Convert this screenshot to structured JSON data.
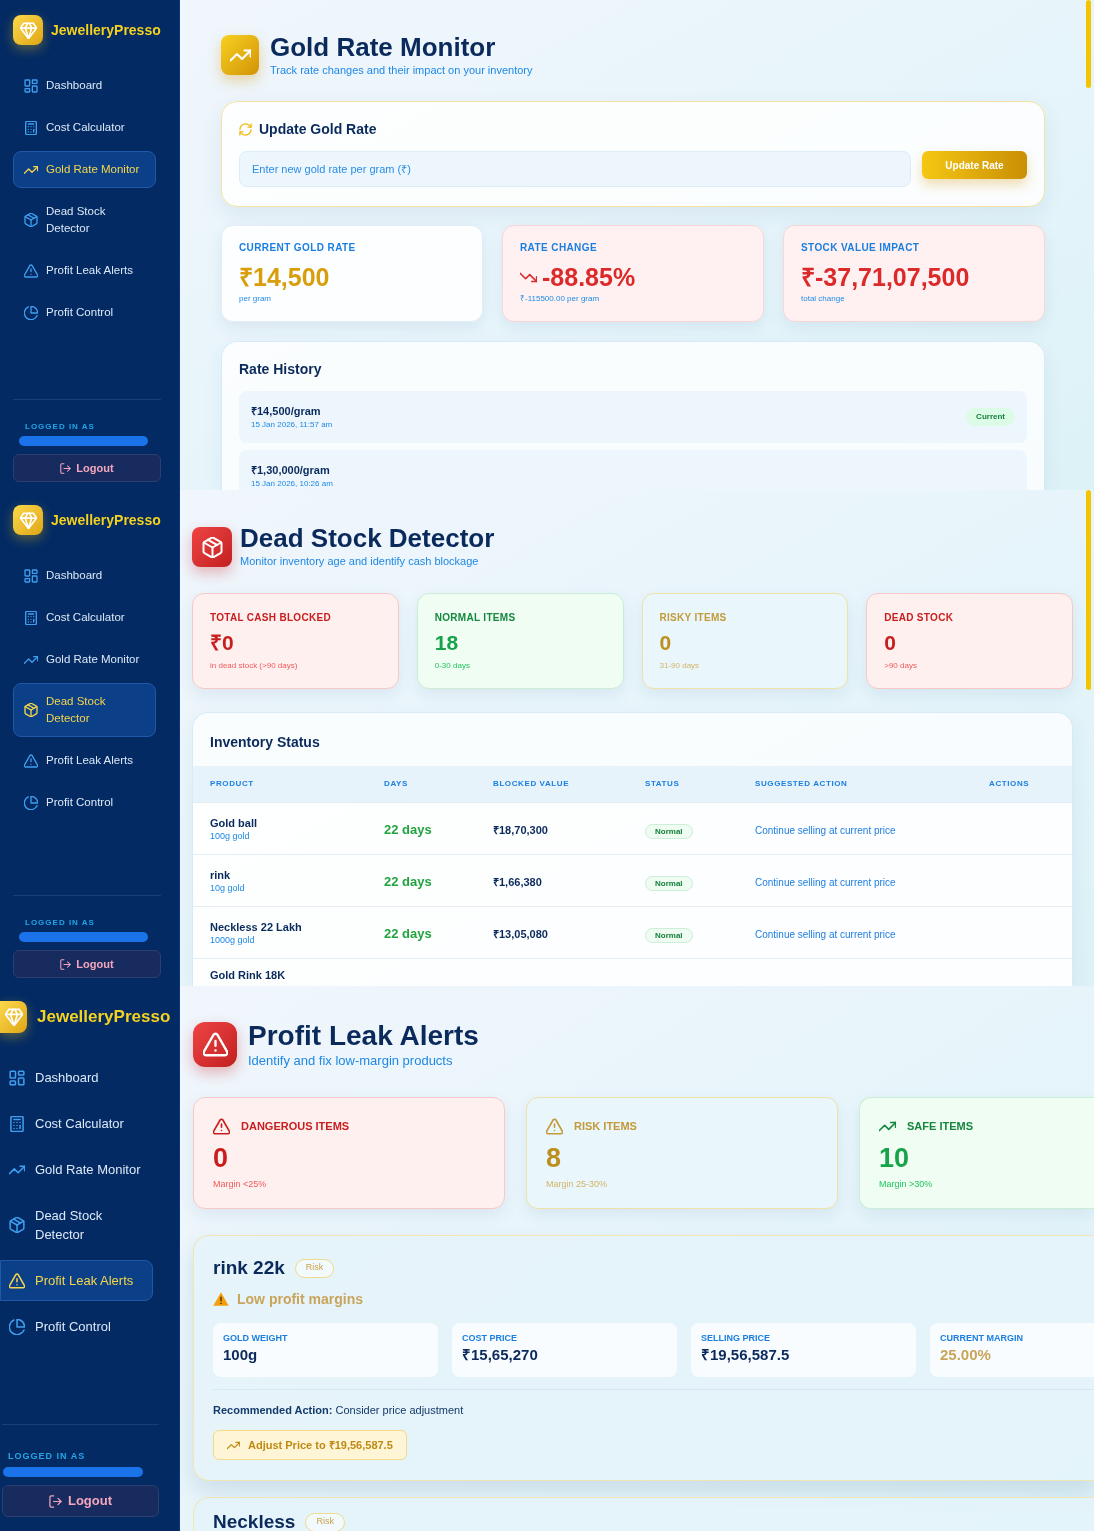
{
  "screens": [
    {
      "sidebar": {
        "brand": "JewelleryPresso",
        "nav": [
          {
            "label": "Dashboard",
            "selected": false
          },
          {
            "label": "Cost Calculator",
            "selected": false
          },
          {
            "label": "Gold Rate Monitor",
            "selected": true
          },
          {
            "label": "Dead Stock Detector",
            "selected": false
          },
          {
            "label": "Profit Leak Alerts",
            "selected": false
          },
          {
            "label": "Profit Control",
            "selected": false
          }
        ],
        "account_label": "LOGGED IN AS",
        "logout": "Logout"
      },
      "scrollbar": true,
      "page": {
        "kind": "rates",
        "title": "Gold Rate Monitor",
        "subtitle": "Track rate changes and their impact on your inventory",
        "update": {
          "heading": "Update Gold Rate",
          "placeholder": "Enter new gold rate per gram (₹)",
          "button": "Update Rate"
        },
        "stats": [
          {
            "kind": "plain",
            "label": "CURRENT GOLD RATE",
            "value": "₹14,500",
            "note": "per gram"
          },
          {
            "kind": "loss",
            "label": "RATE CHANGE",
            "value": "-88.85%",
            "note": "₹-115500.00 per gram",
            "falling": true
          },
          {
            "kind": "loss",
            "label": "STOCK VALUE IMPACT",
            "value": "₹-37,71,07,500",
            "note": "total change"
          }
        ],
        "history": {
          "heading": "Rate History",
          "entries": [
            {
              "rate": "₹14,500/gram",
              "time": "15 Jan 2026, 11:57 am",
              "badge": "Current"
            },
            {
              "rate": "₹1,30,000/gram",
              "time": "15 Jan 2026, 10:26 am"
            }
          ]
        }
      }
    },
    {
      "sidebar": {
        "brand": "JewelleryPresso",
        "nav": [
          {
            "label": "Dashboard",
            "selected": false
          },
          {
            "label": "Cost Calculator",
            "selected": false
          },
          {
            "label": "Gold Rate Monitor",
            "selected": false
          },
          {
            "label": "Dead Stock Detector",
            "selected": true
          },
          {
            "label": "Profit Leak Alerts",
            "selected": false
          },
          {
            "label": "Profit Control",
            "selected": false
          }
        ],
        "account_label": "LOGGED IN AS",
        "logout": "Logout"
      },
      "scrollbar": true,
      "page": {
        "kind": "stock",
        "title": "Dead Stock Detector",
        "subtitle": "Monitor inventory age and identify cash blockage",
        "stats": [
          {
            "kind": "danger",
            "label": "TOTAL CASH BLOCKED",
            "value": "₹0",
            "note": "in dead stock (>90 days)"
          },
          {
            "kind": "success",
            "label": "NORMAL ITEMS",
            "value": "18",
            "note": "0-30 days"
          },
          {
            "kind": "warning",
            "label": "RISKY ITEMS",
            "value": "0",
            "note": "31-90 days"
          },
          {
            "kind": "danger",
            "label": "DEAD STOCK",
            "value": "0",
            "note": ">90 days"
          }
        ],
        "table": {
          "heading": "Inventory Status",
          "columns": [
            "PRODUCT",
            "DAYS",
            "BLOCKED VALUE",
            "STATUS",
            "SUGGESTED ACTION",
            "ACTIONS"
          ],
          "rows": [
            {
              "product": "Gold ball",
              "weight": "100g gold",
              "days": "22 days",
              "blocked": "₹18,70,300",
              "status": "Normal",
              "action": "Continue selling at current price"
            },
            {
              "product": "rink",
              "weight": "10g gold",
              "days": "22 days",
              "blocked": "₹1,66,380",
              "status": "Normal",
              "action": "Continue selling at current price"
            },
            {
              "product": "Neckless 22 Lakh",
              "weight": "1000g gold",
              "days": "22 days",
              "blocked": "₹13,05,080",
              "status": "Normal",
              "action": "Continue selling at current price"
            },
            {
              "product": "Gold Rink 18K"
            }
          ]
        }
      }
    },
    {
      "sidebar": {
        "brand": "JewelleryPresso",
        "nav": [
          {
            "label": "Dashboard",
            "selected": false
          },
          {
            "label": "Cost Calculator",
            "selected": false
          },
          {
            "label": "Gold Rate Monitor",
            "selected": false
          },
          {
            "label": "Dead Stock Detector",
            "selected": false
          },
          {
            "label": "Profit Leak Alerts",
            "selected": true
          },
          {
            "label": "Profit Control",
            "selected": false
          }
        ],
        "account_label": "LOGGED IN AS",
        "logout": "Logout"
      },
      "page": {
        "kind": "alerts",
        "title": "Profit Leak Alerts",
        "subtitle": "Identify and fix low-margin products",
        "stats": [
          {
            "kind": "danger",
            "label": "DANGEROUS ITEMS",
            "value": "0",
            "note": "Margin <25%"
          },
          {
            "kind": "warning",
            "label": "RISK ITEMS",
            "value": "8",
            "note": "Margin 25-30%"
          },
          {
            "kind": "success",
            "label": "SAFE ITEMS",
            "value": "10",
            "note": "Margin >30%"
          }
        ],
        "alerts": [
          {
            "name": "rink 22k",
            "badge": "Risk",
            "reason": "Low profit margins",
            "metrics": [
              {
                "kind": "value",
                "label": "GOLD WEIGHT",
                "value": "100g"
              },
              {
                "kind": "value",
                "label": "COST PRICE",
                "value": "₹15,65,270"
              },
              {
                "kind": "value",
                "label": "SELLING PRICE",
                "value": "₹19,56,587.5"
              },
              {
                "kind": "margin",
                "label": "CURRENT MARGIN",
                "value": "25.00%"
              }
            ],
            "recommendation": "**Recommended Action:** Consider price adjustment",
            "action": "Adjust Price to ₹19,56,587.5"
          },
          {
            "name": "Neckless",
            "badge": "Risk"
          }
        ]
      }
    }
  ]
}
